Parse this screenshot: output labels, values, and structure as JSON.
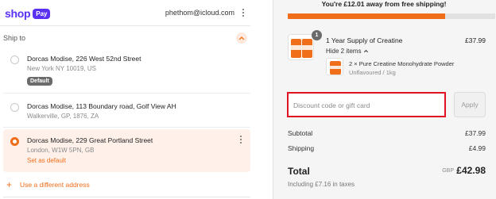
{
  "shop": {
    "logo_word": "shop",
    "logo_pay": "Pay",
    "email": "phethom@icloud.com"
  },
  "ship_to": {
    "label": "Ship to",
    "addresses": [
      {
        "name": "Dorcas Modise, 226 West 52nd Street",
        "detail": "New York NY 10019, US",
        "badge": "Default",
        "selected": false
      },
      {
        "name": "Dorcas Modise, 113 Boundary road, Golf View AH",
        "detail": "Walkerville, GP, 1876, ZA",
        "selected": false
      },
      {
        "name": "Dorcas Modise, 229 Great Portland Street",
        "detail": "London, W1W 5PN, GB",
        "action": "Set as default",
        "selected": true
      }
    ],
    "use_different": "Use a different address"
  },
  "summary": {
    "shipping_message": "You're £12.01 away from free shipping!",
    "progress_fraction": 0.76,
    "product": {
      "qty": "1",
      "title": "1 Year Supply of Creatine",
      "price": "£37.99",
      "toggle": "Hide 2 items",
      "item_name": "2 × Pure Creatine Monohydrate Powder",
      "item_variant": "Unflavoured / 1kg"
    },
    "discount": {
      "placeholder": "Discount code or gift card",
      "value": ""
    },
    "apply_label": "Apply",
    "subtotal_label": "Subtotal",
    "subtotal_value": "£37.99",
    "shipping_label": "Shipping",
    "shipping_value": "£4.99",
    "total_label": "Total",
    "currency": "GBP",
    "total_value": "£42.98",
    "taxes": "Including £7.16 in taxes"
  },
  "colors": {
    "accent": "#f06d1a",
    "shop_purple": "#5a31f4",
    "highlight_border": "#e0141e"
  }
}
